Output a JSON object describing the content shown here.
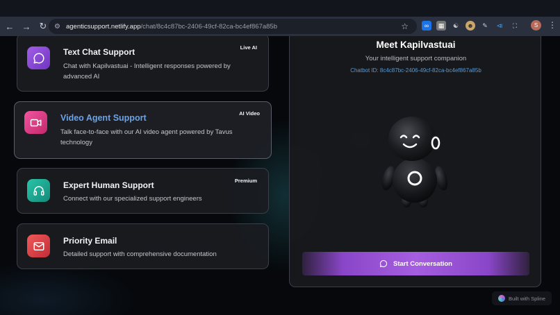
{
  "browser": {
    "url_host": "agenticsupport.netlify.app",
    "url_path": "/chat/8c4c87bc-2406-49cf-82ca-bc4ef867a85b",
    "profile_initial": "S"
  },
  "cards": [
    {
      "title": "Text Chat Support",
      "description": "Chat with Kapilvastuai - Intelligent responses powered by advanced AI",
      "badge": "Live AI",
      "icon": "chat-bubble-icon",
      "color": "#9b4fd8"
    },
    {
      "title": "Video Agent Support",
      "description": "Talk face-to-face with our AI video agent powered by Tavus technology",
      "badge": "AI Video",
      "icon": "video-camera-icon",
      "color": "#e0408e"
    },
    {
      "title": "Expert Human Support",
      "description": "Connect with our specialized support engineers",
      "badge": "Premium",
      "icon": "headphones-icon",
      "color": "#1fa896"
    },
    {
      "title": "Priority Email",
      "description": "Detailed support with comprehensive documentation",
      "badge": "",
      "icon": "mail-icon",
      "color": "#e0404a"
    }
  ],
  "panel": {
    "title": "Meet Kapilvastuai",
    "subtitle": "Your intelligent support companion",
    "chatbot_id": "Chatbot ID: 8c4c87bc-2406-49cf-82ca-bc4ef867a85b",
    "start_button": "Start Conversation"
  },
  "footer": {
    "built_with": "Built with Spline"
  },
  "colors": {
    "accent_purple": "#a65ee0",
    "link_blue": "#5b9bd5",
    "video_title_blue": "#6aa3e8"
  }
}
